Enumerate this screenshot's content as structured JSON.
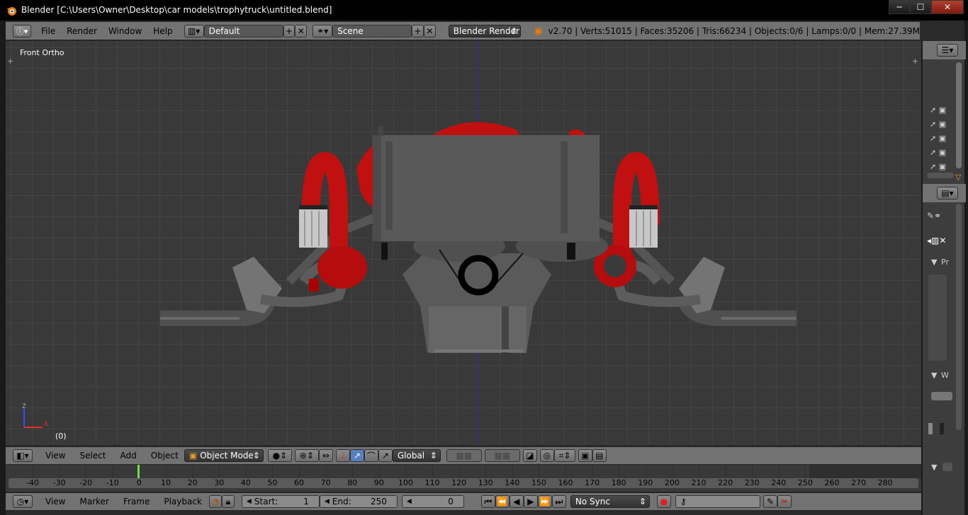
{
  "window": {
    "title": "Blender [C:\\Users\\Owner\\Desktop\\car models\\trophytruck\\untitled.blend]",
    "minimize": "─",
    "maximize": "☐",
    "close": "✕"
  },
  "info_header": {
    "menus": [
      "File",
      "Render",
      "Window",
      "Help"
    ],
    "layout_name": "Default",
    "scene_name": "Scene",
    "render_engine": "Blender Render",
    "stats": "v2.70 | Verts:51015 | Faces:35206 | Tris:66234 | Objects:0/6 | Lamps:0/0 | Mem:27.39M"
  },
  "viewport": {
    "view_name": "Front Ortho",
    "frame_label": "(0)",
    "axis_z": "Z",
    "axis_x": "X"
  },
  "view3d_header": {
    "menus": [
      "View",
      "Select",
      "Add",
      "Object"
    ],
    "mode": "Object Mode",
    "orientation": "Global"
  },
  "timeline": {
    "ticks": [
      "-40",
      "-30",
      "-20",
      "-10",
      "0",
      "10",
      "20",
      "30",
      "40",
      "50",
      "60",
      "70",
      "80",
      "90",
      "100",
      "110",
      "120",
      "130",
      "140",
      "150",
      "160",
      "170",
      "180",
      "190",
      "200",
      "210",
      "220",
      "230",
      "240",
      "250",
      "260",
      "270",
      "280"
    ],
    "current_frame_value": 0
  },
  "timeline_header": {
    "menus": [
      "View",
      "Marker",
      "Frame",
      "Playback"
    ],
    "start_label": "Start:",
    "start_value": "1",
    "end_label": "End:",
    "end_value": "250",
    "current_frame": "0",
    "sync": "No Sync"
  },
  "right_panel": {
    "section_pr": "Pr",
    "section_w": "W"
  },
  "colors": {
    "header_bg": "#727272",
    "viewport_bg": "#393939",
    "engine_red": "#c01010",
    "engine_grey": "#555555",
    "timeline_cursor": "#6ce04a"
  }
}
